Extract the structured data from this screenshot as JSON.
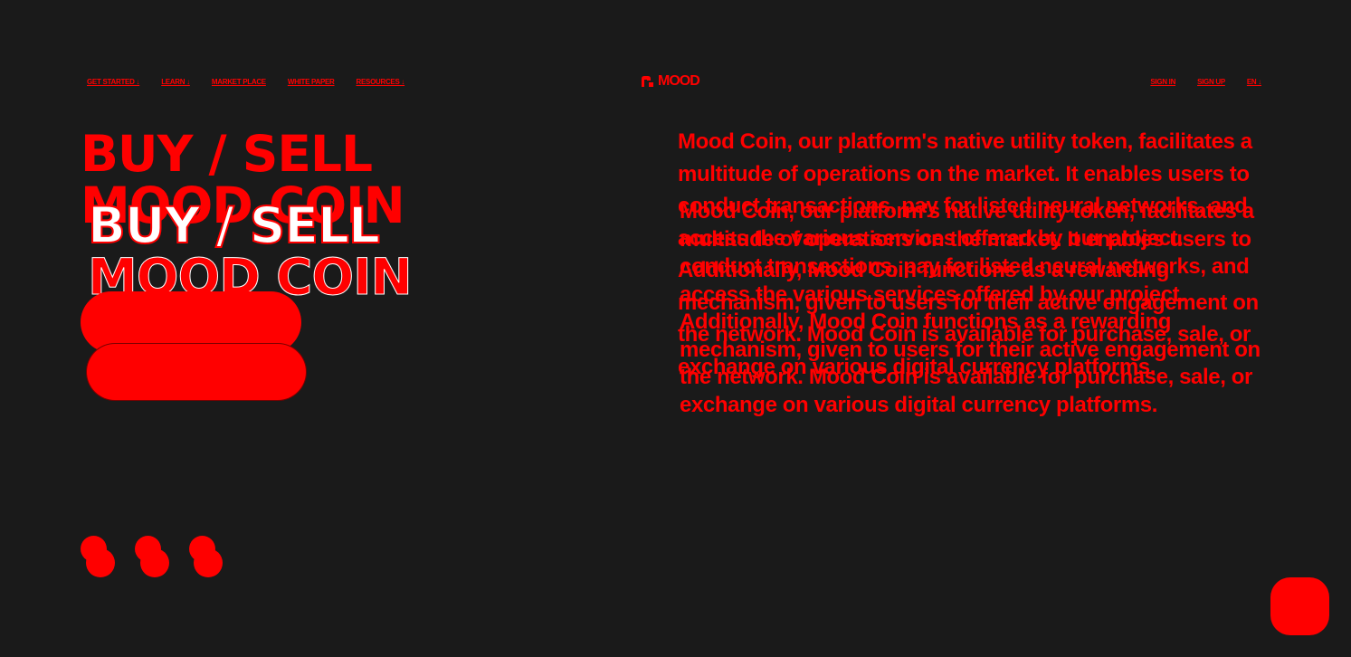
{
  "nav": {
    "get_started": "GET STARTED ↓",
    "learn": "LEARN ↓",
    "market_place": "MARKET PLACE",
    "white_paper": "WHITE PAPER",
    "resources": "RESOURCES ↓"
  },
  "logo": {
    "text": "MOOD",
    "icon": "mood-logo-icon"
  },
  "auth": {
    "sign_in": "SIGN IN",
    "sign_up": "SIGN UP",
    "language": "EN ↓"
  },
  "hero": {
    "headline_line_1": "BUY / SELL",
    "headline_line_2": "MOOD COIN",
    "description": "Mood Coin, our platform's native utility token, facilitates a multitude of operations on the market. It enables users to conduct transactions, pay for listed neural networks, and access the various services offered by our project. Additionally, Mood Coin functions as a rewarding mechanism, given to users for their active engagement on the network. Mood Coin is available for purchase, sale, or exchange on various digital currency platforms."
  },
  "theme": {
    "background": "#1a1a1a",
    "accent": "#ff0000",
    "highlight": "#ffffff"
  }
}
